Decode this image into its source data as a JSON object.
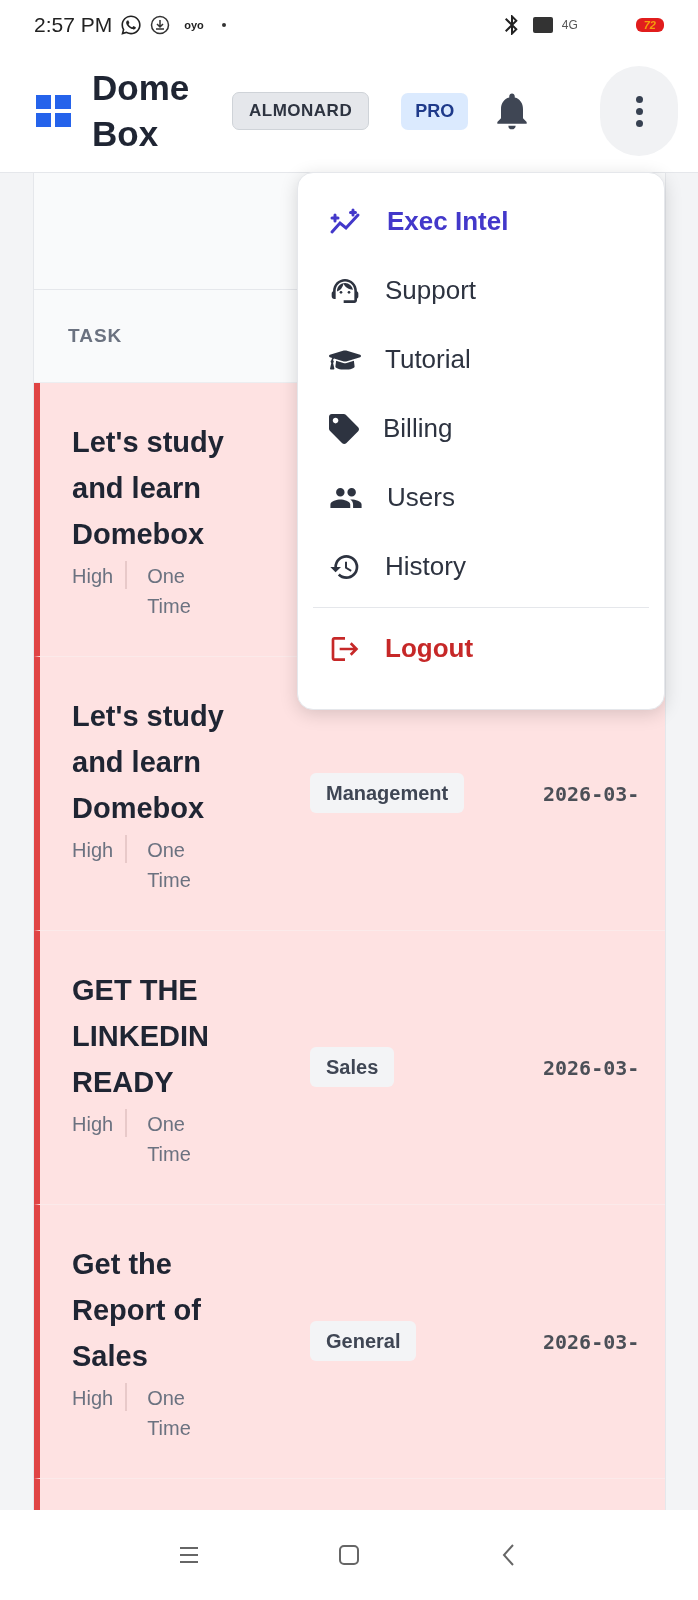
{
  "status_bar": {
    "time": "2:57 PM",
    "app_badge": "oyo",
    "network": "4G",
    "battery": "72"
  },
  "header": {
    "brand": "Dome Box",
    "workspace": "ALMONARD",
    "plan": "PRO"
  },
  "table": {
    "columns": [
      "TASK"
    ],
    "rows": [
      {
        "title": "Let's study and learn Domebox",
        "priority": "High",
        "frequency": "One Time"
      },
      {
        "title": "Let's study and learn Domebox",
        "priority": "High",
        "frequency": "One Time",
        "category": "Management",
        "date": "2026-03-"
      },
      {
        "title": "GET THE LINKEDIN READY",
        "priority": "High",
        "frequency": "One Time",
        "category": "Sales",
        "date": "2026-03-"
      },
      {
        "title": "Get the Report of Sales",
        "priority": "High",
        "frequency": "One Time",
        "category": "General",
        "date": "2026-03-"
      }
    ]
  },
  "menu": {
    "items": [
      {
        "label": "Exec Intel",
        "kind": "accent"
      },
      {
        "label": "Support",
        "kind": "normal"
      },
      {
        "label": "Tutorial",
        "kind": "normal"
      },
      {
        "label": "Billing",
        "kind": "normal"
      },
      {
        "label": "Users",
        "kind": "normal"
      },
      {
        "label": "History",
        "kind": "normal"
      },
      {
        "label": "Logout",
        "kind": "danger"
      }
    ]
  }
}
